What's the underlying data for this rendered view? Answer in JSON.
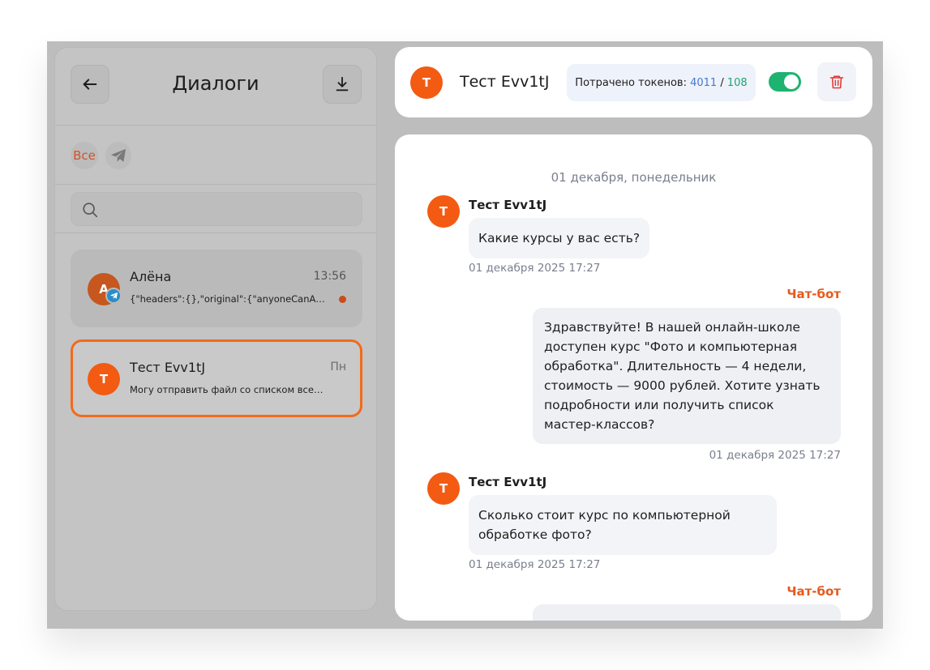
{
  "sidebar": {
    "title": "Диалоги",
    "filters": {
      "all": "Все"
    },
    "search": {
      "placeholder": ""
    },
    "dialogs": [
      {
        "avatar": "А",
        "name": "Алёна",
        "time": "13:56",
        "snippet": "{\"headers\":{},\"original\":{\"anyoneCanAdd...",
        "channel": "telegram",
        "unread": true
      },
      {
        "avatar": "Т",
        "name": "Тест Evv1tJ",
        "time": "Пн",
        "snippet": "Могу отправить файл со списком всех...",
        "selected": true
      }
    ]
  },
  "header": {
    "avatar": "Т",
    "name": "Тест Evv1tJ",
    "tokens_label": "Потрачено токенов:",
    "tokens_spent": "4011",
    "tokens_sep": "/",
    "tokens_extra": "108",
    "bot_enabled": true
  },
  "chat": {
    "date_separator": "01 декабря, понедельник",
    "messages": [
      {
        "from": "user",
        "avatar": "Т",
        "name": "Тест Evv1tJ",
        "text": "Какие курсы у вас есть?",
        "time": "01 декабря 2025 17:27"
      },
      {
        "from": "bot",
        "name": "Чат-бот",
        "text": "Здравствуйте! В нашей онлайн-школе доступен курс \"Фото и компьютерная обработка\". Длительность — 4 недели, стоимость — 9000 рублей. Хотите узнать подробности или получить список мастер-классов?",
        "time": "01 декабря 2025 17:27"
      },
      {
        "from": "user",
        "avatar": "Т",
        "name": "Тест Evv1tJ",
        "text": "Сколько стоит курс по компьютерной обработке фото?",
        "time": "01 декабря 2025 17:27"
      },
      {
        "from": "bot",
        "name": "Чат-бот",
        "text": "",
        "time": ""
      }
    ]
  },
  "colors": {
    "accent": "#f35a12",
    "bot_label": "#e55a1d",
    "toggle_on": "#1eb370",
    "tokens_spent": "#4677d4",
    "tokens_extra": "#1ea56d"
  }
}
